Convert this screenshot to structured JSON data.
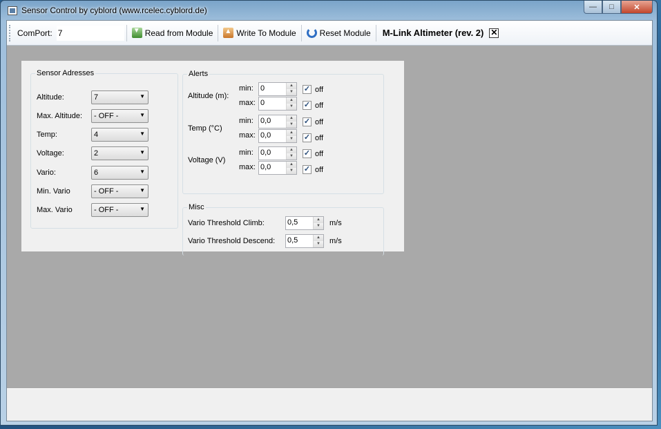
{
  "window": {
    "title": "Sensor Control by cyblord (www.rcelec.cyblord.de)"
  },
  "window_controls": {
    "minimize": "—",
    "maximize": "□",
    "close": "✕"
  },
  "toolbar": {
    "comport_label": "ComPort:",
    "comport_value": "7",
    "read_label": "Read from Module",
    "write_label": "Write To Module",
    "reset_label": "Reset Module",
    "module_title": "M-Link Altimeter (rev. 2)",
    "close_glyph": "✕"
  },
  "sensor_adresses": {
    "title": "Sensor Adresses",
    "rows": [
      {
        "label": "Altitude:",
        "value": "7"
      },
      {
        "label": "Max. Altitude:",
        "value": "- OFF -"
      },
      {
        "label": "Temp:",
        "value": "4"
      },
      {
        "label": "Voltage:",
        "value": "2"
      },
      {
        "label": "Vario:",
        "value": "6"
      },
      {
        "label": "Min. Vario",
        "value": "- OFF -"
      },
      {
        "label": "Max. Vario",
        "value": "- OFF -"
      }
    ]
  },
  "alerts": {
    "title": "Alerts",
    "min_label": "min:",
    "max_label": "max:",
    "off_label": "off",
    "groups": [
      {
        "label": "Altitude (m):",
        "min": "0",
        "max": "0",
        "min_off": true,
        "max_off": true
      },
      {
        "label": "Temp (°C)",
        "min": "0,0",
        "max": "0,0",
        "min_off": true,
        "max_off": true
      },
      {
        "label": "Voltage (V)",
        "min": "0,0",
        "max": "0,0",
        "min_off": true,
        "max_off": true
      }
    ]
  },
  "misc": {
    "title": "Misc",
    "climb_label": "Vario Threshold Climb:",
    "climb_value": "0,5",
    "climb_unit": "m/s",
    "descend_label": "Vario Threshold Descend:",
    "descend_value": "0,5",
    "descend_unit": "m/s"
  },
  "icons": {
    "app": "window-icon",
    "read": "download-arrow-icon",
    "write": "upload-arrow-icon",
    "reset": "refresh-icon"
  }
}
